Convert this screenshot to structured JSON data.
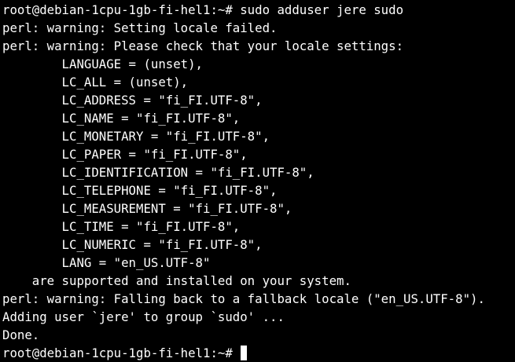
{
  "terminal": {
    "prompt": "root@debian-1cpu-1gb-fi-hel1:~#",
    "lines": [
      "root@debian-1cpu-1gb-fi-hel1:~# sudo adduser jere sudo",
      "perl: warning: Setting locale failed.",
      "perl: warning: Please check that your locale settings:",
      "        LANGUAGE = (unset),",
      "        LC_ALL = (unset),",
      "        LC_ADDRESS = \"fi_FI.UTF-8\",",
      "        LC_NAME = \"fi_FI.UTF-8\",",
      "        LC_MONETARY = \"fi_FI.UTF-8\",",
      "        LC_PAPER = \"fi_FI.UTF-8\",",
      "        LC_IDENTIFICATION = \"fi_FI.UTF-8\",",
      "        LC_TELEPHONE = \"fi_FI.UTF-8\",",
      "        LC_MEASUREMENT = \"fi_FI.UTF-8\",",
      "        LC_TIME = \"fi_FI.UTF-8\",",
      "        LC_NUMERIC = \"fi_FI.UTF-8\",",
      "        LANG = \"en_US.UTF-8\"",
      "    are supported and installed on your system.",
      "perl: warning: Falling back to a fallback locale (\"en_US.UTF-8\").",
      "Adding user `jere' to group `sudo' ...",
      "Done."
    ],
    "colors": {
      "background": "#000000",
      "foreground": "#ffffff",
      "cursor": "#ffffff"
    }
  }
}
